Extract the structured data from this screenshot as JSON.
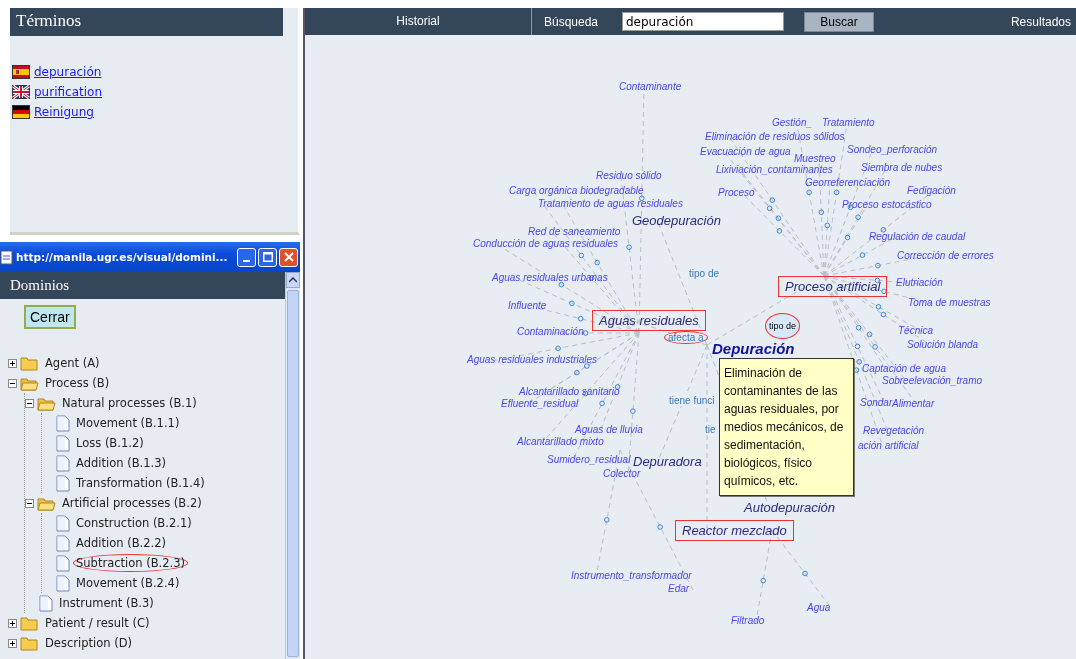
{
  "terms_panel": {
    "title": "Términos",
    "items": [
      {
        "label": "depuración",
        "kind": "es"
      },
      {
        "label": "purification",
        "kind": "en"
      },
      {
        "label": "Reinigung",
        "kind": "de"
      }
    ]
  },
  "popup": {
    "title": "http://manila.ugr.es/visual/domini...",
    "header": "Dominios",
    "close_button": "Cerrar",
    "tree": [
      {
        "label": "Agent (A)",
        "kind": "folder",
        "expanded": false,
        "circled": false
      },
      {
        "label": "Process (B)",
        "kind": "folder",
        "expanded": true,
        "circled": false,
        "children": [
          {
            "label": "Natural processes (B.1)",
            "kind": "folder",
            "expanded": true,
            "circled": false,
            "children": [
              {
                "label": "Movement (B.1.1)",
                "kind": "document",
                "circled": false
              },
              {
                "label": "Loss (B.1.2)",
                "kind": "document",
                "circled": false
              },
              {
                "label": "Addition (B.1.3)",
                "kind": "document",
                "circled": false
              },
              {
                "label": "Transformation (B.1.4)",
                "kind": "document",
                "circled": false
              }
            ]
          },
          {
            "label": "Artificial processes (B.2)",
            "kind": "folder",
            "expanded": true,
            "circled": false,
            "children": [
              {
                "label": "Construction (B.2.1)",
                "kind": "document",
                "circled": false
              },
              {
                "label": "Addition (B.2.2)",
                "kind": "document",
                "circled": false
              },
              {
                "label": "Subtraction (B.2.3)",
                "kind": "document",
                "circled": true
              },
              {
                "label": "Movement (B.2.4)",
                "kind": "document",
                "circled": false
              }
            ]
          },
          {
            "label": "Instrument (B.3)",
            "kind": "document",
            "circled": false
          }
        ]
      },
      {
        "label": "Patient / result (C)",
        "kind": "folder",
        "expanded": false,
        "circled": false
      },
      {
        "label": "Description (D)",
        "kind": "folder",
        "expanded": false,
        "circled": false
      }
    ]
  },
  "topbar": {
    "history_tab": "Historial",
    "search_label": "Búsqueda",
    "search_value": "depuración",
    "search_button": "Buscar",
    "results_tab": "Resultados"
  },
  "graph": {
    "terms": [
      {
        "label": "Contaminante"
      },
      {
        "label": "Gestión_"
      },
      {
        "label": "Tratamiento"
      },
      {
        "label": "Eliminación de residuos sólidos"
      },
      {
        "label": "Evacuación de agua"
      },
      {
        "label": "Sondeo_perforación"
      },
      {
        "label": "Muestreo"
      },
      {
        "label": "Residuo sólido"
      },
      {
        "label": "Lixiviación_contaminantes"
      },
      {
        "label": "Siembra de nubes"
      },
      {
        "label": "Georreferenciación"
      },
      {
        "label": "Carga orgánica biodegradable"
      },
      {
        "label": "Proceso"
      },
      {
        "label": "Fedigación"
      },
      {
        "label": "Tratamiento de aguas residuales"
      },
      {
        "label": "Proceso estocástico"
      },
      {
        "label": "Red de saneamiento"
      },
      {
        "label": "Conducción de aguas residuales"
      },
      {
        "label": "Regulación de caudal"
      },
      {
        "label": "Corrección de errores"
      },
      {
        "label": "Aguas residuales urbanas"
      },
      {
        "label": "Elutriación"
      },
      {
        "label": "Influente"
      },
      {
        "label": "Toma de muestras"
      },
      {
        "label": "Contaminación"
      },
      {
        "label": "Técnica"
      },
      {
        "label": "Solución blanda"
      },
      {
        "label": "Aguas residuales industriales"
      },
      {
        "label": "Captación de agua"
      },
      {
        "label": "Sobreelevación_tramo"
      },
      {
        "label": "Alcantarillado sanitario"
      },
      {
        "label": "Efluente_residual"
      },
      {
        "label": "Sondar"
      },
      {
        "label": "Alimentar"
      },
      {
        "label": "Aguas de lluvia"
      },
      {
        "label": "Revegetación"
      },
      {
        "label": "Alcantarillado mixto"
      },
      {
        "label": "ación artificial"
      },
      {
        "label": "Sumidero_residual"
      },
      {
        "label": "Colector"
      },
      {
        "label": "Instrumento_transformador"
      },
      {
        "label": "Edar"
      },
      {
        "label": "Agua"
      },
      {
        "label": "Filtrado"
      }
    ],
    "concepts": [
      {
        "label": "Geodepuración",
        "kind": "concept",
        "boxed": false
      },
      {
        "label": "Proceso artificial",
        "kind": "concept",
        "boxed": true
      },
      {
        "label": "Aguas residuales",
        "kind": "concept",
        "boxed": true
      },
      {
        "label": "Depuración",
        "kind": "center",
        "boxed": false
      },
      {
        "label": "Depuradora",
        "kind": "concept",
        "boxed": false
      },
      {
        "label": "Autodepuración",
        "kind": "concept",
        "boxed": false
      },
      {
        "label": "Reactor mezclado",
        "kind": "concept",
        "boxed": true
      }
    ],
    "relations": [
      {
        "label": "tipo de",
        "kind": "plain",
        "circled": false
      },
      {
        "label": "tipo de",
        "kind": "tag",
        "circled": true
      },
      {
        "label": "afecta a",
        "kind": "plain",
        "circled": true
      },
      {
        "label": "tiene funci",
        "kind": "plain",
        "circled": false
      },
      {
        "label": "tie",
        "kind": "plain",
        "circled": false
      }
    ],
    "tooltip": "Eliminación de contaminantes de las aguas residuales, por medios mecánicos, de sedimentación, biológicos, físico químicos, etc."
  }
}
